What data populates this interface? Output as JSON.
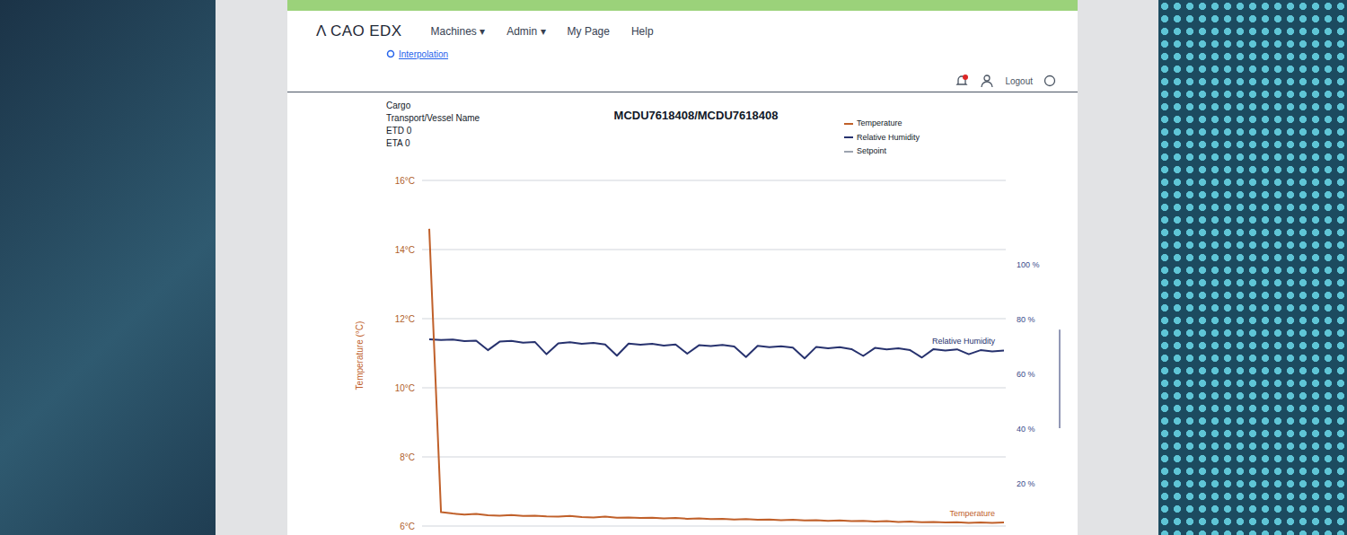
{
  "app": {
    "logo": "Λ CAO EDX",
    "nav": [
      {
        "label": "Machines ▾"
      },
      {
        "label": "Admin ▾"
      },
      {
        "label": "My Page"
      },
      {
        "label": "Help"
      }
    ],
    "logout": "Logout"
  },
  "link": {
    "label": "Interpolation"
  },
  "info": [
    "Cargo",
    "Transport/Vessel Name",
    "ETD 0",
    "ETA 0"
  ],
  "title": "MCDU7618408/MCDU7618408",
  "legend": [
    {
      "label": "Temperature",
      "color": "#c0602a"
    },
    {
      "label": "Relative Humidity",
      "color": "#27326e"
    },
    {
      "label": "Setpoint",
      "color": "#9ca3af"
    }
  ],
  "chart": {
    "y_axis_label": "Temperature (°C)",
    "left_ticks": [
      {
        "label": "16°C",
        "value": 16
      },
      {
        "label": "14°C",
        "value": 14
      },
      {
        "label": "12°C",
        "value": 12
      },
      {
        "label": "10°C",
        "value": 10
      },
      {
        "label": "8°C",
        "value": 8
      },
      {
        "label": "6°C",
        "value": 6
      }
    ],
    "right_ticks": [
      {
        "label": "100 %",
        "value": 100
      },
      {
        "label": "80 %",
        "value": 80
      },
      {
        "label": "60 %",
        "value": 60
      },
      {
        "label": "40 %",
        "value": 40
      },
      {
        "label": "20 %",
        "value": 20
      }
    ],
    "series": [
      {
        "label": "Relative Humidity",
        "color": "#27326e",
        "axis": "right",
        "values": [
          72.5,
          72.2,
          72.4,
          71.8,
          72.0,
          68.5,
          71.6,
          71.9,
          71.2,
          71.5,
          67.0,
          71.0,
          71.4,
          70.8,
          71.1,
          70.6,
          66.5,
          70.9,
          70.5,
          70.8,
          70.2,
          70.6,
          67.2,
          70.3,
          70.0,
          70.4,
          69.8,
          66.0,
          70.1,
          69.6,
          69.9,
          69.4,
          65.5,
          69.7,
          69.2,
          69.6,
          68.9,
          66.4,
          69.3,
          68.8,
          69.2,
          68.5,
          65.8,
          68.9,
          68.4,
          68.8,
          67.0,
          68.5,
          68.0,
          68.4
        ]
      },
      {
        "label": "Temperature",
        "color": "#c0602a",
        "axis": "left",
        "values": [
          14.6,
          6.4,
          6.36,
          6.33,
          6.35,
          6.31,
          6.3,
          6.32,
          6.29,
          6.3,
          6.28,
          6.27,
          6.29,
          6.26,
          6.25,
          6.27,
          6.24,
          6.25,
          6.23,
          6.24,
          6.22,
          6.23,
          6.21,
          6.22,
          6.2,
          6.21,
          6.19,
          6.2,
          6.18,
          6.19,
          6.17,
          6.18,
          6.16,
          6.17,
          6.15,
          6.16,
          6.14,
          6.15,
          6.13,
          6.14,
          6.12,
          6.13,
          6.11,
          6.12,
          6.1,
          6.11,
          6.09,
          6.1,
          6.09,
          6.1
        ]
      }
    ]
  }
}
